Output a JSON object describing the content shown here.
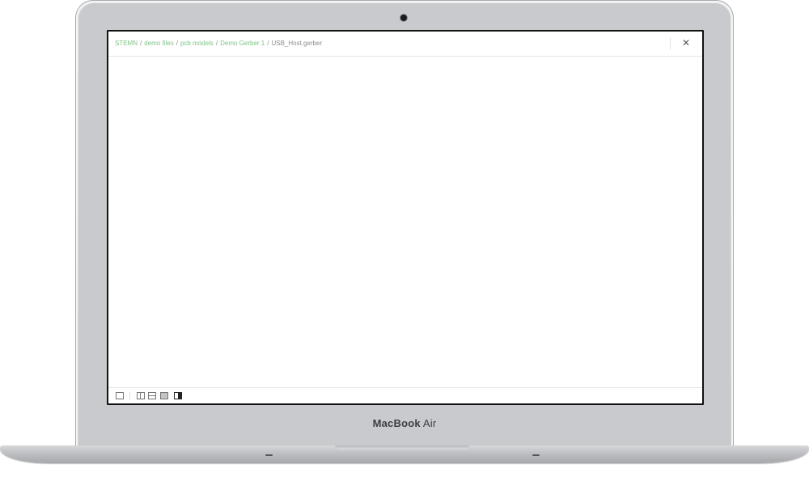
{
  "device": {
    "brand_bold": "MacBook",
    "brand_light": "Air"
  },
  "breadcrumb": {
    "items": [
      {
        "label": "STEMN",
        "link": true
      },
      {
        "label": "demo files",
        "link": true
      },
      {
        "label": "pcb models",
        "link": true
      },
      {
        "label": "Demo Gerber 1",
        "link": true
      },
      {
        "label": "USB_Host.gerber",
        "link": false
      }
    ],
    "separator": "/"
  },
  "close": {
    "glyph": "✕",
    "icon": "close-icon"
  },
  "layout_toolbar": {
    "buttons": [
      {
        "icon": "layout-single-icon"
      },
      {
        "icon": "layout-columns-icon"
      },
      {
        "icon": "layout-rows-icon"
      },
      {
        "icon": "layout-grid-icon"
      },
      {
        "icon": "layout-split-icon"
      }
    ]
  },
  "colors": {
    "link": "#7dc383",
    "text_muted": "#8c8c8c",
    "border": "#e4e4e4"
  }
}
